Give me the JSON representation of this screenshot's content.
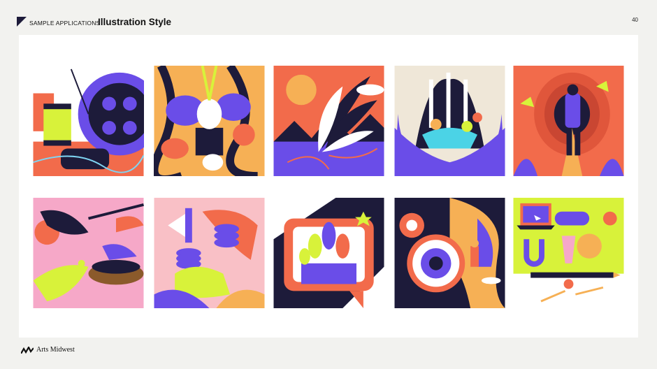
{
  "header": {
    "section_label": "SAMPLE APPLICATIONS",
    "title": "Illustration Style",
    "page_number": "40"
  },
  "footer": {
    "logo_text": "Arts Midwest"
  },
  "colors": {
    "background": "#f2f2ef",
    "panel": "#ffffff",
    "orange": "#f26b4b",
    "purple": "#6a4de8",
    "lime": "#d8f23a",
    "navy": "#1d1b3a",
    "pink": "#f6a8c8"
  },
  "illustrations": [
    {
      "subject": "sewing-thread-and-film-reel"
    },
    {
      "subject": "musicians-and-vegetables"
    },
    {
      "subject": "feathers-and-mountain-sunset"
    },
    {
      "subject": "hands-holding-birch-forest"
    },
    {
      "subject": "traveler-in-tunnel-with-birds"
    },
    {
      "subject": "birds-and-nest"
    },
    {
      "subject": "hand-with-coins-and-megaphone"
    },
    {
      "subject": "speech-bubble-with-flowers"
    },
    {
      "subject": "eye-and-explorer-in-cosmos"
    },
    {
      "subject": "laptop-magnet-and-pencil"
    }
  ]
}
